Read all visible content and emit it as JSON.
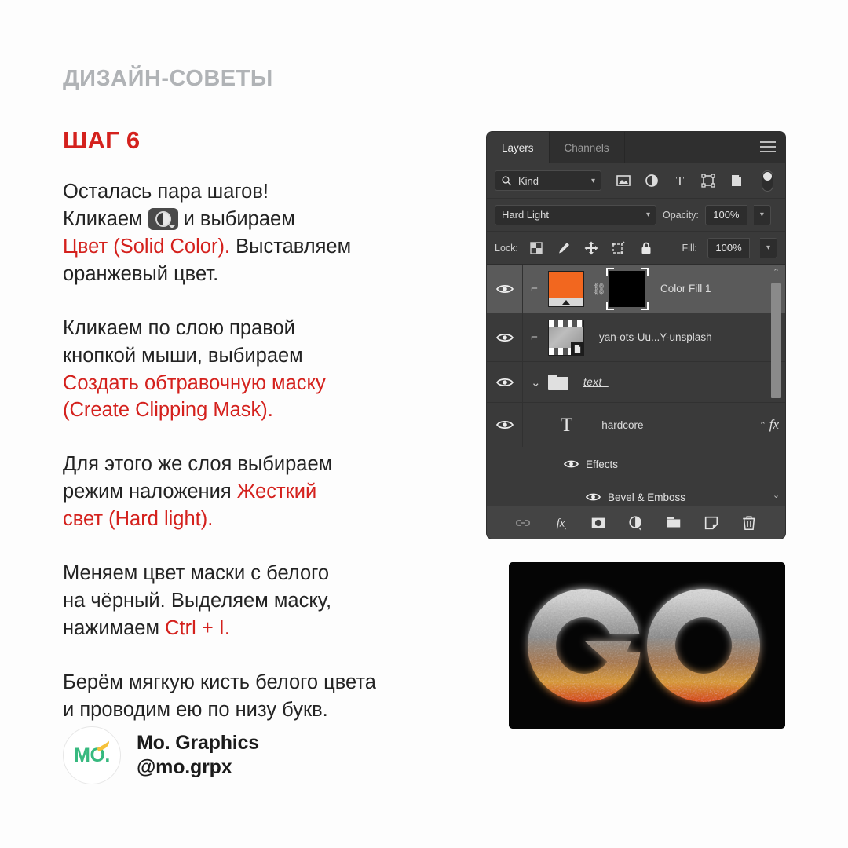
{
  "post": {
    "kicker": "ДИЗАЙН-СОВЕТЫ",
    "step_title": "ШАГ 6",
    "accent_red": "#d4211d",
    "kicker_gray": "#b0b3b6",
    "body_color": "#232323",
    "background": "#fdfdfd",
    "paragraphs": [
      {
        "id": "p1",
        "lines": [
          {
            "segments": [
              {
                "text": "Осталась пара шагов!",
                "color": "black"
              }
            ]
          },
          {
            "segments": [
              {
                "text": "Кликаем ",
                "color": "black"
              },
              {
                "icon": "adjustment-layer-icon"
              },
              {
                "text": " и выбираем",
                "color": "black"
              }
            ]
          },
          {
            "segments": [
              {
                "text": "Цвет (Solid Color).",
                "color": "red"
              },
              {
                "text": " Выставляем",
                "color": "black"
              }
            ]
          },
          {
            "segments": [
              {
                "text": "оранжевый цвет.",
                "color": "black"
              }
            ]
          }
        ]
      },
      {
        "id": "p2",
        "lines": [
          {
            "segments": [
              {
                "text": "Кликаем по слою правой",
                "color": "black"
              }
            ]
          },
          {
            "segments": [
              {
                "text": "кнопкой мыши, выбираем",
                "color": "black"
              }
            ]
          },
          {
            "segments": [
              {
                "text": "Создать обтравочную маску",
                "color": "red"
              }
            ]
          },
          {
            "segments": [
              {
                "text": "(Create Clipping Mask).",
                "color": "red"
              }
            ]
          }
        ]
      },
      {
        "id": "p3",
        "lines": [
          {
            "segments": [
              {
                "text": "Для этого же слоя выбираем",
                "color": "black"
              }
            ]
          },
          {
            "segments": [
              {
                "text": "режим наложения ",
                "color": "black"
              },
              {
                "text": "Жесткий",
                "color": "red"
              }
            ]
          },
          {
            "segments": [
              {
                "text": "свет (Hard light).",
                "color": "red"
              }
            ]
          }
        ]
      },
      {
        "id": "p4",
        "lines": [
          {
            "segments": [
              {
                "text": "Меняем цвет маски с белого",
                "color": "black"
              }
            ]
          },
          {
            "segments": [
              {
                "text": "на чёрный. Выделяем маску,",
                "color": "black"
              }
            ]
          },
          {
            "segments": [
              {
                "text": "нажимаем ",
                "color": "black"
              },
              {
                "text": "Ctrl + I.",
                "color": "red"
              }
            ]
          }
        ]
      },
      {
        "id": "p5",
        "lines": [
          {
            "segments": [
              {
                "text": "Берём мягкую кисть белого цвета",
                "color": "black"
              }
            ]
          },
          {
            "segments": [
              {
                "text": "и проводим ею по низу букв.",
                "color": "black"
              }
            ]
          }
        ]
      }
    ]
  },
  "text_lines": {
    "p1_l1": "Осталась пара шагов!",
    "p1_l2a": "Кликаем",
    "p1_l2b": "и выбираем",
    "p1_l3a": "Цвет (Solid Color).",
    "p1_l3b": "Выставляем",
    "p1_l4": "оранжевый цвет.",
    "p2_l1": "Кликаем по слою правой",
    "p2_l2": "кнопкой мыши, выбираем",
    "p2_l3": "Создать обтравочную маску",
    "p2_l4": "(Create Clipping Mask).",
    "p3_l1": "Для этого же слоя выбираем",
    "p3_l2a": "режим наложения",
    "p3_l2b": "Жесткий",
    "p3_l3": "свет (Hard light).",
    "p4_l1": "Меняем цвет маски с белого",
    "p4_l2": "на чёрный. Выделяем маску,",
    "p4_l3a": "нажимаем",
    "p4_l3b": "Ctrl + I.",
    "p5_l1": "Берём мягкую кисть белого цвета",
    "p5_l2": "и проводим ею по низу букв."
  },
  "brand": {
    "logo_text": "MO",
    "logo_dot": ".",
    "name": "Mo. Graphics",
    "handle": "@mo.grpx",
    "logo_green": "#37b97f",
    "logo_yellow": "#f5c13a"
  },
  "photoshop": {
    "panel_bg": "#3a3a3a",
    "tabs": [
      {
        "label": "Layers",
        "active": true
      },
      {
        "label": "Channels",
        "active": false
      }
    ],
    "menu_icon": "hamburger-menu-icon",
    "filter_row": {
      "search_icon": "search-icon",
      "kind_value": "Kind",
      "chevron": "chevron-down-icon",
      "icons": [
        "image-filter-icon",
        "adjustment-filter-icon",
        "type-filter-icon",
        "shape-filter-icon",
        "smart-object-filter-icon"
      ],
      "toggle": "filter-enable-toggle"
    },
    "blend_row": {
      "blend_mode": "Hard Light",
      "opacity_label": "Opacity:",
      "opacity_value": "100%"
    },
    "lock_row": {
      "lock_label": "Lock:",
      "icons": [
        "lock-transparent-pixels-icon",
        "lock-image-pixels-icon",
        "lock-position-icon",
        "lock-artboard-nesting-icon",
        "lock-all-icon"
      ],
      "fill_label": "Fill:",
      "fill_value": "100%"
    },
    "layers": [
      {
        "name": "Color Fill 1",
        "visible": true,
        "selected": true,
        "clipped": true,
        "thumb": "orange-fill-thumbnail",
        "fill_color": "#f2671f",
        "mask": "black-layer-mask",
        "link_icon": "link-icon"
      },
      {
        "name": "yan-ots-Uu...Y-unsplash",
        "visible": true,
        "selected": false,
        "clipped": true,
        "thumb": "photo-smart-object-thumbnail",
        "badge": "smart-object-badge"
      },
      {
        "name": "text_",
        "visible": true,
        "selected": false,
        "type": "group",
        "expanded": true,
        "icon": "folder-icon",
        "caret": "chevron-down-icon"
      },
      {
        "name": "hardcore",
        "visible": true,
        "selected": false,
        "type": "text",
        "icon": "type-T-icon",
        "fx": "fx",
        "caret": "chevron-up-icon"
      }
    ],
    "effects": [
      {
        "label": "Effects",
        "visible": true,
        "indent": 1
      },
      {
        "label": "Bevel & Emboss",
        "visible": true,
        "indent": 2
      }
    ],
    "scrollbar": {
      "up_arrow": "chevron-up-icon",
      "down_arrow": "chevron-down-icon"
    },
    "bottom_toolbar": [
      "link-layers-icon",
      "layer-style-fx-icon",
      "add-layer-mask-icon",
      "new-adjustment-layer-icon",
      "new-group-icon",
      "new-layer-icon",
      "delete-layer-icon"
    ]
  },
  "artwork": {
    "name": "hardcore-logo-preview",
    "letters": [
      "G",
      "O"
    ],
    "background": "#050505",
    "top_color": "#dcdcdc",
    "mid_color": "#c98a3c",
    "bottom_color": "#d81b0d"
  }
}
